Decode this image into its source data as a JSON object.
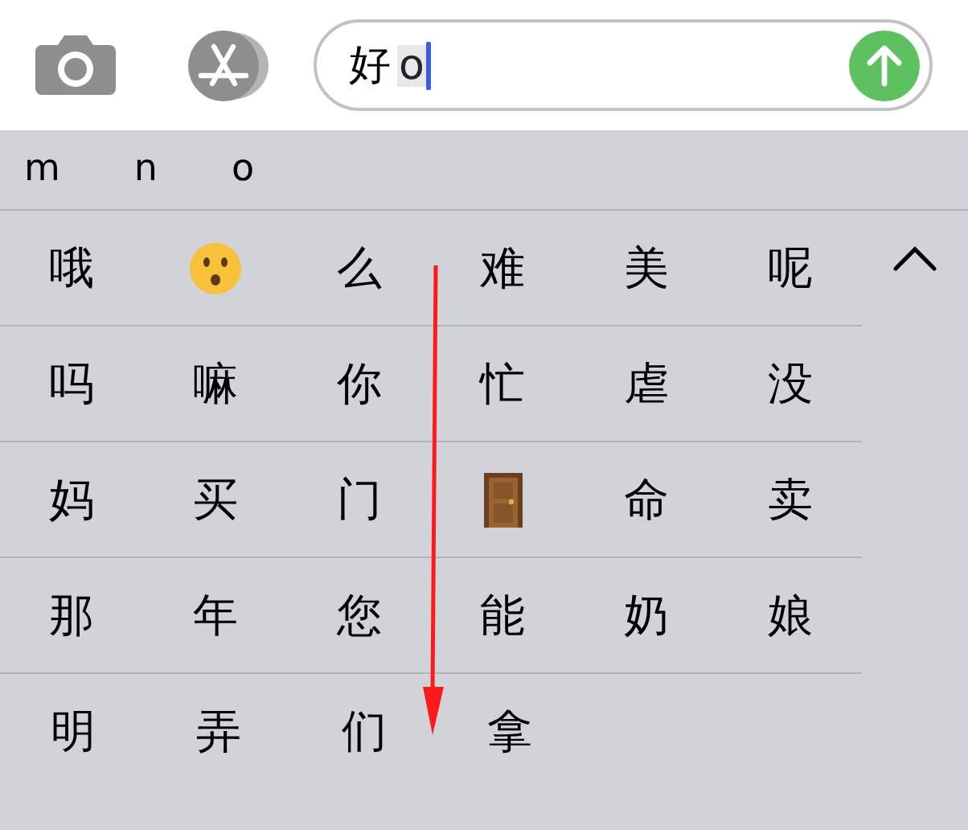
{
  "message_field": {
    "text": "好",
    "composing": "o"
  },
  "pinyin_options": [
    "m",
    "n",
    "o"
  ],
  "candidate_rows": [
    [
      {
        "kind": "text",
        "text": "哦"
      },
      {
        "kind": "emoji-face"
      },
      {
        "kind": "text",
        "text": "么"
      },
      {
        "kind": "text",
        "text": "难"
      },
      {
        "kind": "text",
        "text": "美"
      },
      {
        "kind": "text",
        "text": "呢"
      }
    ],
    [
      {
        "kind": "text",
        "text": "吗"
      },
      {
        "kind": "text",
        "text": "嘛"
      },
      {
        "kind": "text",
        "text": "你"
      },
      {
        "kind": "text",
        "text": "忙"
      },
      {
        "kind": "text",
        "text": "虐"
      },
      {
        "kind": "text",
        "text": "没"
      }
    ],
    [
      {
        "kind": "text",
        "text": "妈"
      },
      {
        "kind": "text",
        "text": "买"
      },
      {
        "kind": "text",
        "text": "门"
      },
      {
        "kind": "emoji-door"
      },
      {
        "kind": "text",
        "text": "命"
      },
      {
        "kind": "text",
        "text": "卖"
      }
    ],
    [
      {
        "kind": "text",
        "text": "那"
      },
      {
        "kind": "text",
        "text": "年"
      },
      {
        "kind": "text",
        "text": "您"
      },
      {
        "kind": "text",
        "text": "能"
      },
      {
        "kind": "text",
        "text": "奶"
      },
      {
        "kind": "text",
        "text": "娘"
      }
    ],
    [
      {
        "kind": "text",
        "text": "明"
      },
      {
        "kind": "text",
        "text": "弄"
      },
      {
        "kind": "text",
        "text": "们"
      },
      {
        "kind": "text",
        "text": "拿"
      }
    ]
  ]
}
